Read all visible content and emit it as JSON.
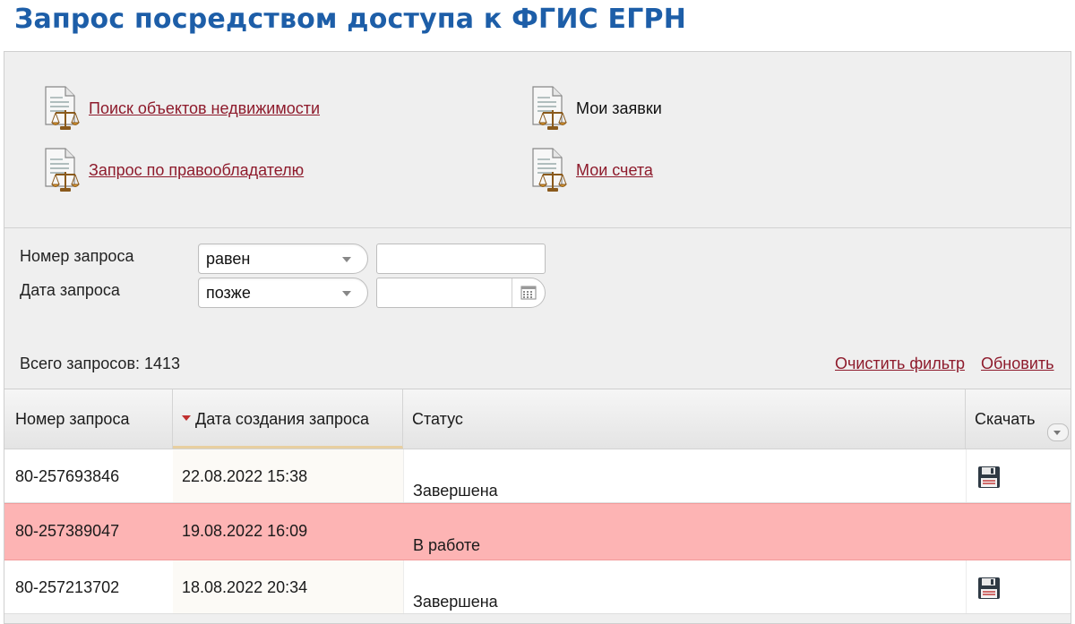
{
  "page": {
    "title": "Запрос посредством доступа к ФГИС ЕГРН"
  },
  "menu": {
    "search_objects": "Поиск объектов недвижимости",
    "my_requests": "Мои заявки",
    "owner_request": "Запрос по правообладателю",
    "my_accounts": "Мои счета"
  },
  "filter": {
    "request_number_label": "Номер запроса",
    "request_number_operator": "равен",
    "request_number_value": "",
    "request_date_label": "Дата запроса",
    "request_date_operator": "позже",
    "request_date_value": ""
  },
  "summary": {
    "total": "Всего запросов: 1413",
    "clear_filter": "Очистить фильтр",
    "refresh": "Обновить"
  },
  "table": {
    "columns": [
      "Номер запроса",
      "Дата создания запроса",
      "Статус",
      "Скачать"
    ],
    "rows": [
      {
        "number": "80-257693846",
        "date": "22.08.2022 15:38",
        "status": "Завершена",
        "download": true
      },
      {
        "number": "80-257389047",
        "date": "19.08.2022 16:09",
        "status": "В работе",
        "download": false
      },
      {
        "number": "80-257213702",
        "date": "18.08.2022 20:34",
        "status": "Завершена",
        "download": true
      }
    ]
  },
  "icons": {
    "menu": "document-scales-icon",
    "calendar": "calendar-icon",
    "download": "floppy-disk-icon"
  },
  "colors": {
    "title": "#1d5ea8",
    "link": "#8e1b2c",
    "highlight_row": "#fdb4b4"
  }
}
